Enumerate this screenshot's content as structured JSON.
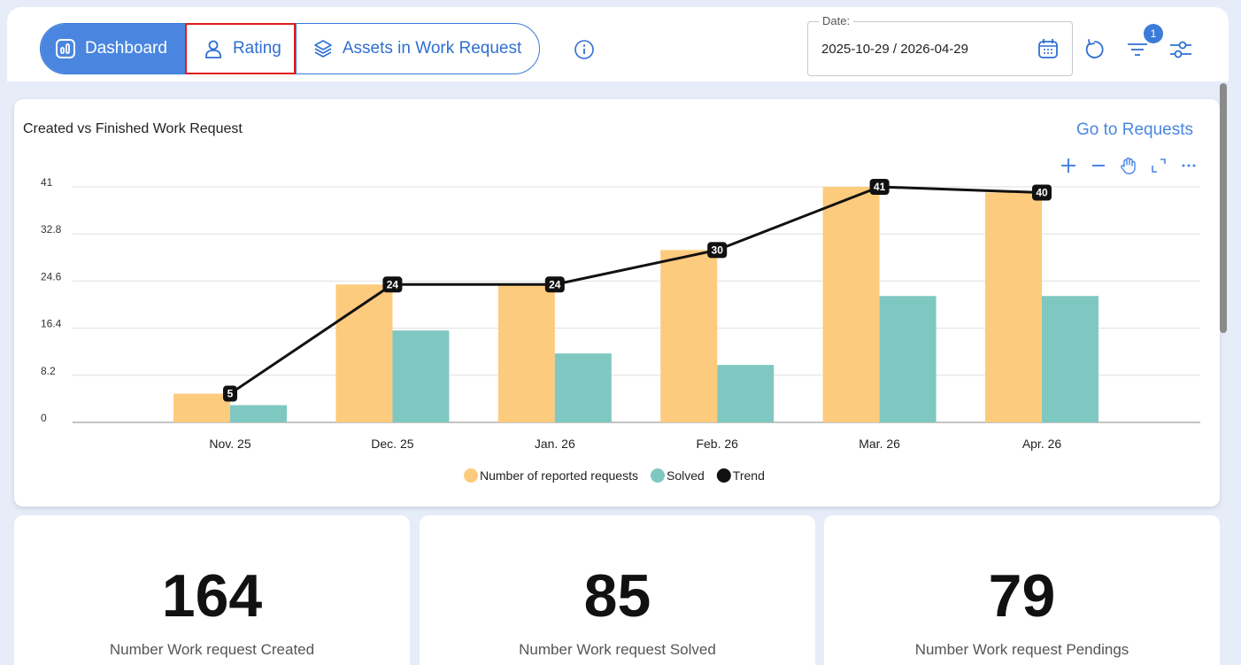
{
  "tabs": [
    {
      "label": "Dashboard",
      "icon": "bar-chart-icon"
    },
    {
      "label": "Rating",
      "icon": "user-icon"
    },
    {
      "label": "Assets in Work Request",
      "icon": "layers-icon"
    }
  ],
  "date_filter": {
    "label": "Date:",
    "value": "2025-10-29 / 2026-04-29"
  },
  "filter_badge": "1",
  "colors": {
    "accent": "#4a86e0",
    "reported": "#fdcb7d",
    "solved": "#7fc8c1",
    "trend": "#111111",
    "highlight": "#e01b1b"
  },
  "chart_card": {
    "title": "Created vs Finished Work Request",
    "goto_label": "Go to Requests"
  },
  "chart_data": {
    "type": "bar",
    "categories": [
      "Nov. 25",
      "Dec. 25",
      "Jan. 26",
      "Feb. 26",
      "Mar. 26",
      "Apr. 26"
    ],
    "series": [
      {
        "name": "Number of reported requests",
        "type": "bar",
        "values": [
          5,
          24,
          24,
          30,
          41,
          40
        ]
      },
      {
        "name": "Solved",
        "type": "bar",
        "values": [
          3,
          16,
          12,
          10,
          22,
          22
        ]
      },
      {
        "name": "Trend",
        "type": "line",
        "values": [
          5,
          24,
          24,
          30,
          41,
          40
        ]
      }
    ],
    "y_ticks": [
      "0",
      "8.2",
      "16.4",
      "24.6",
      "32.8",
      "41"
    ],
    "ylim": [
      0,
      41
    ],
    "grid": true,
    "legend_position": "bottom-center"
  },
  "stats": [
    {
      "value": "164",
      "label": "Number Work request Created"
    },
    {
      "value": "85",
      "label": "Number Work request Solved"
    },
    {
      "value": "79",
      "label": "Number Work request Pendings"
    }
  ]
}
